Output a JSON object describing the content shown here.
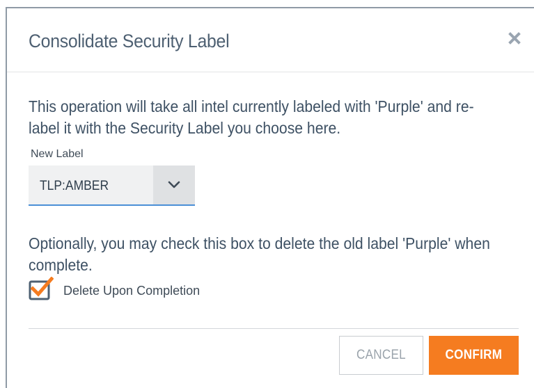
{
  "dialog": {
    "title": "Consolidate Security Label",
    "close_icon": "close-icon",
    "description": "This operation will take all intel currently labeled with 'Purple' and re-label it with the Security Label you choose here.",
    "new_label": {
      "label": "New Label",
      "value": "TLP:AMBER",
      "arrow_icon": "chevron-down-icon"
    },
    "optional_text": "Optionally, you may check this box to delete the old label 'Purple' when complete.",
    "delete_checkbox": {
      "label": "Delete Upon Completion",
      "checked": true
    },
    "buttons": {
      "cancel": "CANCEL",
      "confirm": "CONFIRM"
    }
  },
  "colors": {
    "title": "#4e6072",
    "body_text": "#3e5164",
    "accent": "#f57c20",
    "select_underline": "#4a8fd6",
    "close_icon": "#9aa5b1"
  }
}
